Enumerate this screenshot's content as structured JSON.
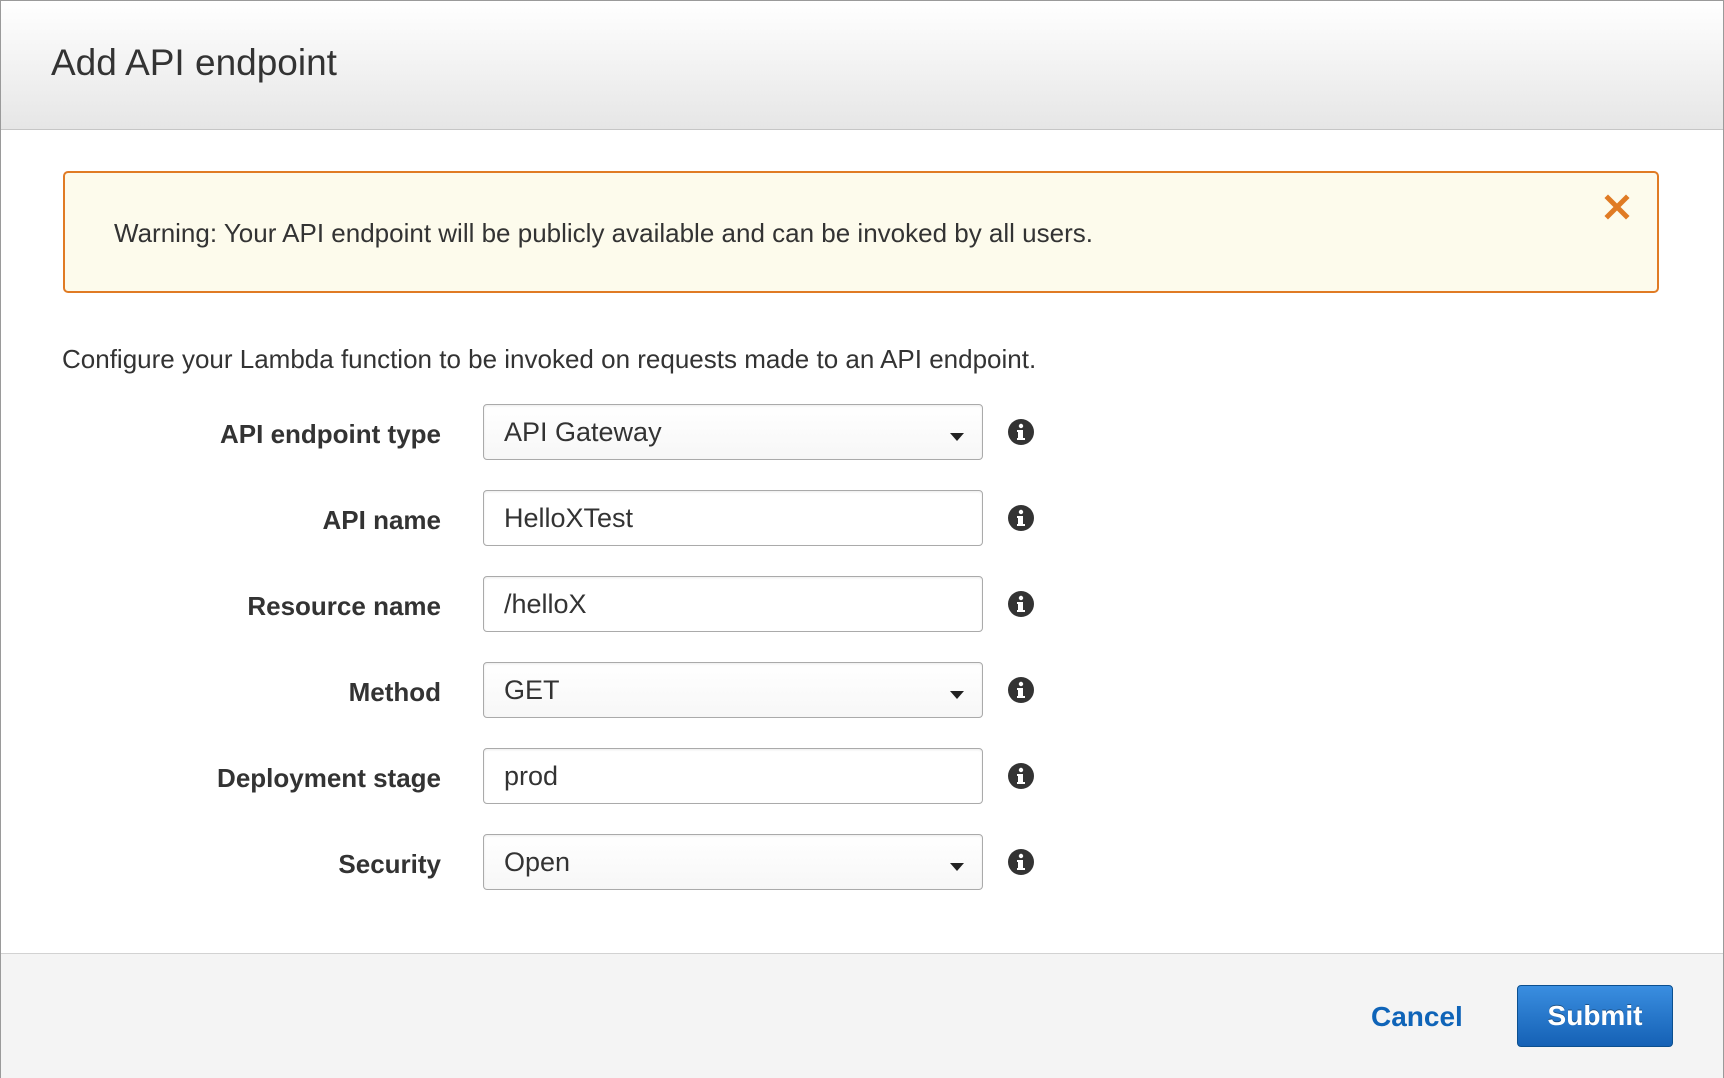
{
  "dialog": {
    "title": "Add API endpoint"
  },
  "warning": {
    "text": "Warning: Your API endpoint will be publicly available and can be invoked by all users.",
    "close_icon": "close-x-icon",
    "border_color": "#e07b24",
    "background": "#fdfbec"
  },
  "intro": "Configure your Lambda function to be invoked on requests made to an API endpoint.",
  "form": {
    "endpoint_type": {
      "label": "API endpoint type",
      "value": "API Gateway",
      "control": "select"
    },
    "api_name": {
      "label": "API name",
      "value": "HelloXTest",
      "control": "text"
    },
    "resource_name": {
      "label": "Resource name",
      "value": "/helloX",
      "control": "text"
    },
    "method": {
      "label": "Method",
      "value": "GET",
      "control": "select"
    },
    "deployment_stage": {
      "label": "Deployment stage",
      "value": "prod",
      "control": "text"
    },
    "security": {
      "label": "Security",
      "value": "Open",
      "control": "select"
    },
    "info_icon": "info-circle-icon"
  },
  "footer": {
    "cancel_label": "Cancel",
    "submit_label": "Submit",
    "link_color": "#0f64b8",
    "primary_color": "#1561b5"
  }
}
